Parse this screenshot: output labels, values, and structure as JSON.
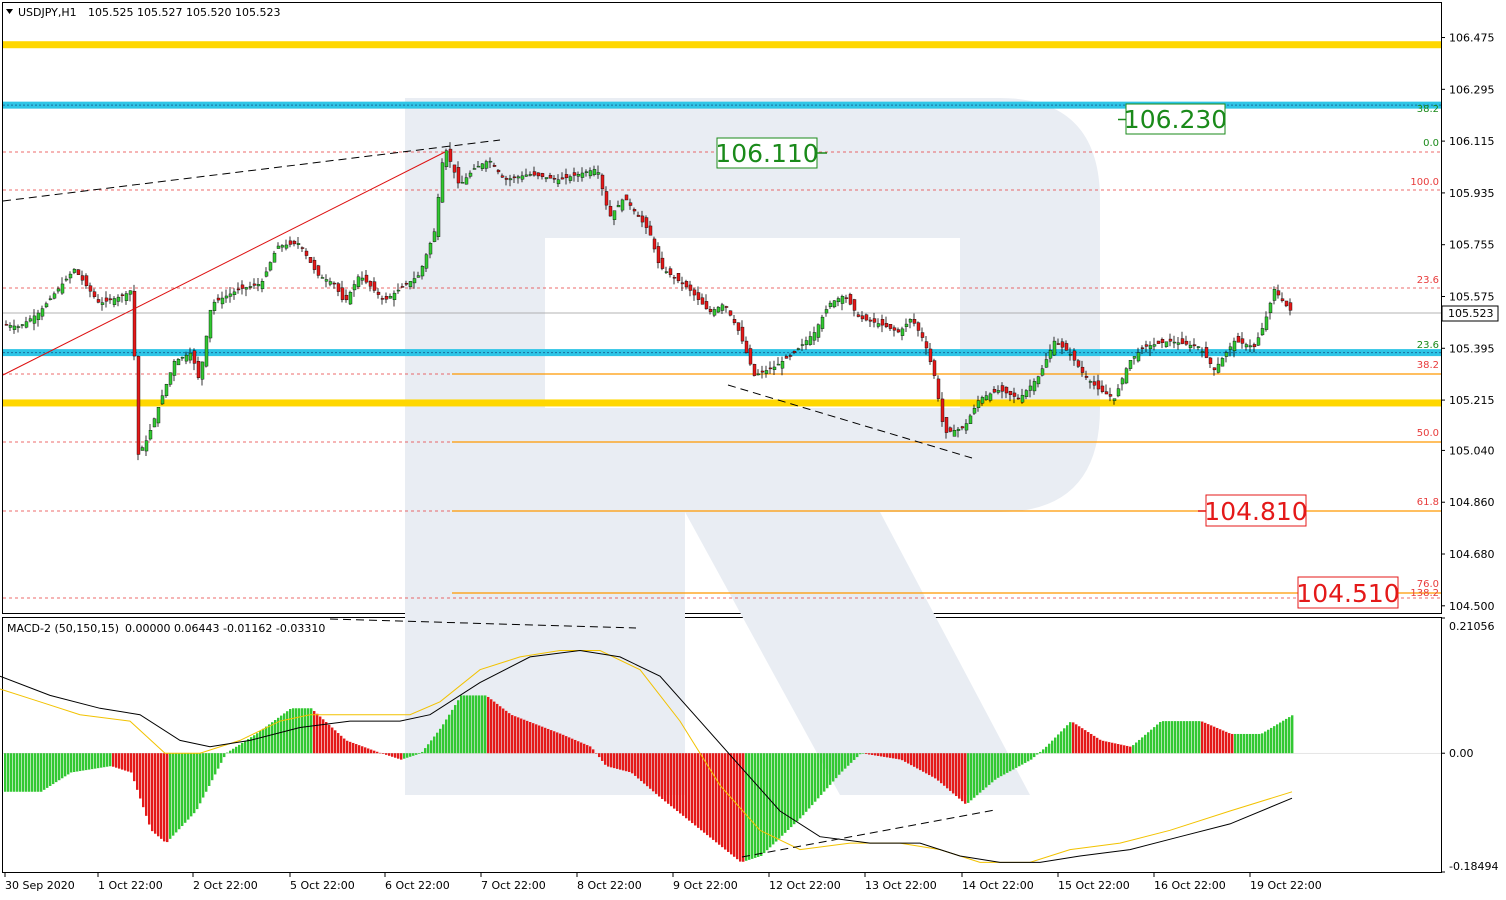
{
  "header": {
    "symbol": "USDJPY,H1",
    "ohlc": "105.525 105.527 105.520 105.523"
  },
  "macd_header": {
    "label": "MACD-2 (50,150,15)",
    "values": "0.00000 0.06443 -0.01162 -0.03310"
  },
  "price_axis": {
    "ticks": [
      "106.475",
      "106.295",
      "106.115",
      "105.935",
      "105.755",
      "105.575",
      "105.395",
      "105.215",
      "105.040",
      "104.860",
      "104.680",
      "104.500"
    ],
    "current_price": "105.523"
  },
  "macd_axis": {
    "ticks": [
      "0.21056",
      "0.00",
      "-0.18494"
    ]
  },
  "date_axis": {
    "labels": [
      "30 Sep 2020",
      "1 Oct 22:00",
      "2 Oct 22:00",
      "5 Oct 22:00",
      "6 Oct 22:00",
      "7 Oct 22:00",
      "8 Oct 22:00",
      "9 Oct 22:00",
      "12 Oct 22:00",
      "13 Oct 22:00",
      "14 Oct 22:00",
      "15 Oct 22:00",
      "16 Oct 22:00",
      "19 Oct 22:00"
    ]
  },
  "fib_labels_upper": [
    "38.2",
    "0.0",
    "100.0",
    "23.6"
  ],
  "fib_labels_lower": [
    "23.6",
    "38.2",
    "50.0",
    "61.8",
    "76.0",
    "138.2"
  ],
  "targets": {
    "t1": "106.230",
    "t2": "106.110",
    "t3": "104.810",
    "t4": "104.510"
  },
  "colors": {
    "bull": "#32c832",
    "bear": "#e41919",
    "gold": "#ffd700",
    "cyan": "#2ec5e6",
    "fib_red": "#e83b3b",
    "fib_orange": "#ff9900",
    "green_box": "#1a8a1a",
    "red_box": "#e41919",
    "watermark": "#e9edf3"
  },
  "chart_data": [
    {
      "type": "candlestick",
      "title": "USDJPY,H1",
      "x_labels": [
        "30 Sep 2020",
        "1 Oct 22:00",
        "2 Oct 22:00",
        "5 Oct 22:00",
        "6 Oct 22:00",
        "7 Oct 22:00",
        "8 Oct 22:00",
        "9 Oct 22:00",
        "12 Oct 22:00",
        "13 Oct 22:00",
        "14 Oct 22:00",
        "15 Oct 22:00",
        "16 Oct 22:00",
        "19 Oct 22:00"
      ],
      "ylim": [
        104.475,
        106.595
      ],
      "horizontal_levels": {
        "gold": [
          106.45,
          105.205
        ],
        "cyan": [
          106.24,
          105.38
        ]
      },
      "last_price": 105.523,
      "price_path": [
        [
          0,
          105.48
        ],
        [
          20,
          105.47
        ],
        [
          40,
          105.52
        ],
        [
          75,
          105.67
        ],
        [
          100,
          105.55
        ],
        [
          125,
          105.58
        ],
        [
          133,
          105.6
        ],
        [
          138,
          105.02
        ],
        [
          148,
          105.08
        ],
        [
          160,
          105.2
        ],
        [
          175,
          105.35
        ],
        [
          192,
          105.38
        ],
        [
          200,
          105.28
        ],
        [
          212,
          105.55
        ],
        [
          240,
          105.6
        ],
        [
          262,
          105.62
        ],
        [
          278,
          105.75
        ],
        [
          300,
          105.76
        ],
        [
          318,
          105.65
        ],
        [
          335,
          105.62
        ],
        [
          345,
          105.55
        ],
        [
          360,
          105.65
        ],
        [
          385,
          105.56
        ],
        [
          400,
          105.6
        ],
        [
          420,
          105.65
        ],
        [
          435,
          105.8
        ],
        [
          445,
          106.1
        ],
        [
          460,
          105.96
        ],
        [
          475,
          106.02
        ],
        [
          490,
          106.05
        ],
        [
          505,
          105.98
        ],
        [
          530,
          106.0
        ],
        [
          560,
          105.98
        ],
        [
          598,
          106.02
        ],
        [
          610,
          105.85
        ],
        [
          625,
          105.92
        ],
        [
          650,
          105.8
        ],
        [
          660,
          105.68
        ],
        [
          690,
          105.6
        ],
        [
          710,
          105.52
        ],
        [
          725,
          105.55
        ],
        [
          740,
          105.45
        ],
        [
          755,
          105.3
        ],
        [
          775,
          105.33
        ],
        [
          795,
          105.38
        ],
        [
          815,
          105.45
        ],
        [
          830,
          105.55
        ],
        [
          845,
          105.58
        ],
        [
          860,
          105.5
        ],
        [
          880,
          105.48
        ],
        [
          900,
          105.45
        ],
        [
          912,
          105.5
        ],
        [
          925,
          105.42
        ],
        [
          935,
          105.3
        ],
        [
          945,
          105.1
        ],
        [
          965,
          105.12
        ],
        [
          980,
          105.22
        ],
        [
          1000,
          105.25
        ],
        [
          1020,
          105.22
        ],
        [
          1040,
          105.3
        ],
        [
          1055,
          105.42
        ],
        [
          1070,
          105.38
        ],
        [
          1085,
          105.3
        ],
        [
          1100,
          105.25
        ],
        [
          1115,
          105.22
        ],
        [
          1130,
          105.35
        ],
        [
          1145,
          105.4
        ],
        [
          1170,
          105.42
        ],
        [
          1200,
          105.4
        ],
        [
          1215,
          105.32
        ],
        [
          1235,
          105.42
        ],
        [
          1255,
          105.4
        ],
        [
          1265,
          105.48
        ],
        [
          1275,
          105.6
        ],
        [
          1285,
          105.55
        ],
        [
          1292,
          105.523
        ]
      ]
    },
    {
      "type": "histogram",
      "title": "MACD-2 (50,150,15)",
      "ylim": [
        -0.18494,
        0.21056
      ],
      "values_label": "0.00000 0.06443 -0.01162 -0.03310",
      "histogram_path": [
        [
          0,
          -0.06
        ],
        [
          40,
          -0.06
        ],
        [
          70,
          -0.03
        ],
        [
          110,
          -0.02
        ],
        [
          130,
          -0.03
        ],
        [
          150,
          -0.12
        ],
        [
          165,
          -0.14
        ],
        [
          195,
          -0.09
        ],
        [
          225,
          0.0
        ],
        [
          255,
          0.03
        ],
        [
          290,
          0.07
        ],
        [
          310,
          0.07
        ],
        [
          345,
          0.02
        ],
        [
          380,
          0.0
        ],
        [
          400,
          -0.01
        ],
        [
          420,
          0.0
        ],
        [
          440,
          0.04
        ],
        [
          460,
          0.09
        ],
        [
          485,
          0.09
        ],
        [
          510,
          0.06
        ],
        [
          560,
          0.03
        ],
        [
          590,
          0.01
        ],
        [
          605,
          -0.02
        ],
        [
          630,
          -0.03
        ],
        [
          660,
          -0.07
        ],
        [
          700,
          -0.12
        ],
        [
          740,
          -0.17
        ],
        [
          760,
          -0.16
        ],
        [
          800,
          -0.1
        ],
        [
          840,
          -0.03
        ],
        [
          860,
          0.0
        ],
        [
          900,
          -0.01
        ],
        [
          935,
          -0.04
        ],
        [
          965,
          -0.08
        ],
        [
          995,
          -0.04
        ],
        [
          1030,
          -0.01
        ],
        [
          1045,
          0.01
        ],
        [
          1070,
          0.05
        ],
        [
          1100,
          0.02
        ],
        [
          1130,
          0.01
        ],
        [
          1160,
          0.05
        ],
        [
          1200,
          0.05
        ],
        [
          1230,
          0.03
        ],
        [
          1260,
          0.03
        ],
        [
          1292,
          0.06
        ]
      ],
      "signal_path": [
        [
          0,
          0.1
        ],
        [
          40,
          0.08
        ],
        [
          80,
          0.06
        ],
        [
          130,
          0.05
        ],
        [
          165,
          0.0
        ],
        [
          200,
          0.0
        ],
        [
          240,
          0.02
        ],
        [
          280,
          0.05
        ],
        [
          310,
          0.06
        ],
        [
          360,
          0.06
        ],
        [
          410,
          0.06
        ],
        [
          440,
          0.08
        ],
        [
          480,
          0.13
        ],
        [
          520,
          0.15
        ],
        [
          560,
          0.16
        ],
        [
          600,
          0.16
        ],
        [
          640,
          0.13
        ],
        [
          680,
          0.05
        ],
        [
          720,
          -0.05
        ],
        [
          760,
          -0.12
        ],
        [
          800,
          -0.15
        ],
        [
          850,
          -0.14
        ],
        [
          900,
          -0.14
        ],
        [
          940,
          -0.15
        ],
        [
          980,
          -0.17
        ],
        [
          1030,
          -0.17
        ],
        [
          1070,
          -0.15
        ],
        [
          1120,
          -0.14
        ],
        [
          1170,
          -0.12
        ],
        [
          1230,
          -0.09
        ],
        [
          1292,
          -0.06
        ]
      ],
      "macd_path": [
        [
          0,
          0.12
        ],
        [
          50,
          0.09
        ],
        [
          100,
          0.07
        ],
        [
          140,
          0.06
        ],
        [
          180,
          0.02
        ],
        [
          210,
          0.01
        ],
        [
          250,
          0.02
        ],
        [
          300,
          0.04
        ],
        [
          350,
          0.05
        ],
        [
          400,
          0.05
        ],
        [
          430,
          0.06
        ],
        [
          480,
          0.11
        ],
        [
          530,
          0.15
        ],
        [
          580,
          0.16
        ],
        [
          620,
          0.15
        ],
        [
          660,
          0.12
        ],
        [
          700,
          0.05
        ],
        [
          740,
          -0.02
        ],
        [
          780,
          -0.09
        ],
        [
          820,
          -0.13
        ],
        [
          870,
          -0.14
        ],
        [
          920,
          -0.14
        ],
        [
          960,
          -0.16
        ],
        [
          1000,
          -0.17
        ],
        [
          1040,
          -0.17
        ],
        [
          1080,
          -0.16
        ],
        [
          1130,
          -0.15
        ],
        [
          1180,
          -0.13
        ],
        [
          1230,
          -0.11
        ],
        [
          1292,
          -0.07
        ]
      ]
    }
  ]
}
